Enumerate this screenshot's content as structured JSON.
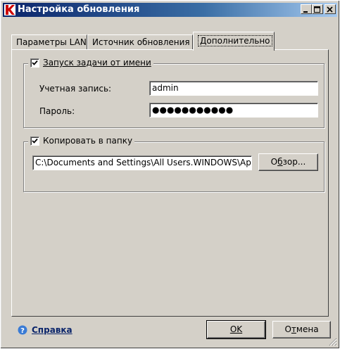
{
  "window": {
    "title": "Настройка обновления",
    "accent": "#0a246a",
    "brand_icon_color": "#cc0000"
  },
  "tabs": [
    {
      "label": "Параметры LAN",
      "active": false
    },
    {
      "label": "Источник обновления",
      "active": false
    },
    {
      "label": "Дополнительно",
      "active": true
    }
  ],
  "run_as": {
    "checkbox_label": "Запуск задачи от имени",
    "checked": true,
    "account_label": "Учетная запись:",
    "account_value": "admin",
    "password_label": "Пароль:",
    "password_value": "●●●●●●●●●●●"
  },
  "copy_to_folder": {
    "checkbox_label": "Копировать в папку",
    "checked": true,
    "path_value": "C:\\Documents and Settings\\All Users.WINDOWS\\Appl",
    "browse_label_pre": "О",
    "browse_label_u": "б",
    "browse_label_post": "зор..."
  },
  "footer": {
    "help_label": "Справка",
    "help_icon": "question-icon",
    "ok_label": "OK",
    "cancel_label_pre": "О",
    "cancel_label_u": "т",
    "cancel_label_post": "мена"
  }
}
